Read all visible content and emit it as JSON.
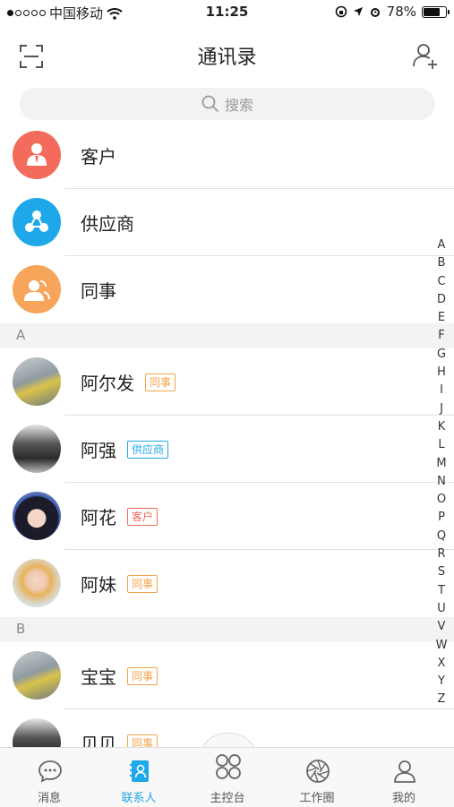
{
  "status_bar": {
    "carrier": "中国移动",
    "time": "11:25",
    "battery": "78%",
    "battery_level": 0.78
  },
  "nav": {
    "title": "通讯录"
  },
  "search": {
    "placeholder": "搜索"
  },
  "categories": [
    {
      "label": "客户",
      "color": "#f26b5b"
    },
    {
      "label": "供应商",
      "color": "#1ea8ea"
    },
    {
      "label": "同事",
      "color": "#f7a55b"
    }
  ],
  "sections": [
    {
      "letter": "A",
      "contacts": [
        {
          "name": "阿尔发",
          "tag": "同事"
        },
        {
          "name": "阿强",
          "tag": "供应商"
        },
        {
          "name": "阿花",
          "tag": "客户"
        },
        {
          "name": "阿妹",
          "tag": "同事"
        }
      ]
    },
    {
      "letter": "B",
      "contacts": [
        {
          "name": "宝宝",
          "tag": "同事"
        },
        {
          "name": "贝贝",
          "tag": "同事"
        }
      ]
    }
  ],
  "index_letters": [
    "A",
    "B",
    "C",
    "D",
    "E",
    "F",
    "G",
    "H",
    "I",
    "J",
    "K",
    "L",
    "M",
    "N",
    "O",
    "P",
    "Q",
    "R",
    "S",
    "T",
    "U",
    "V",
    "W",
    "X",
    "Y",
    "Z"
  ],
  "tabs": [
    {
      "label": "消息",
      "icon": "message-icon"
    },
    {
      "label": "联系人",
      "icon": "contacts-icon",
      "active": true
    },
    {
      "label": "主控台",
      "icon": "dashboard-icon"
    },
    {
      "label": "工作圈",
      "icon": "aperture-icon"
    },
    {
      "label": "我的",
      "icon": "profile-icon"
    }
  ],
  "colors": {
    "accent": "#1fa8e8",
    "coworker": "#f5a34a",
    "supplier": "#1fa8e8",
    "customer": "#ef6b5d"
  }
}
